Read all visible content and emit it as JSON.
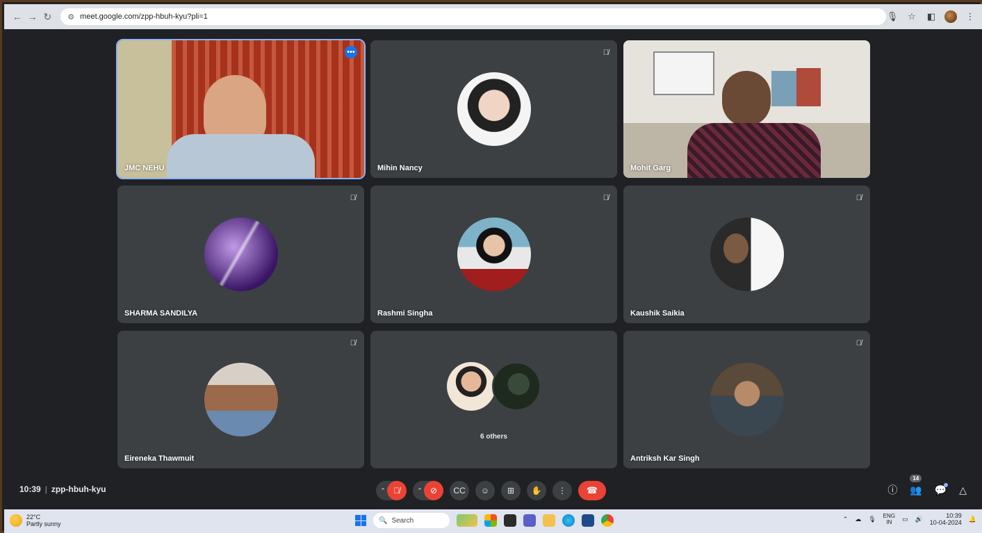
{
  "browser": {
    "url": "meet.google.com/zpp-hbuh-kyu?pli=1"
  },
  "tiles": [
    {
      "name": "JMC NEHU"
    },
    {
      "name": "Mihin Nancy"
    },
    {
      "name": "Mohit Garg"
    },
    {
      "name": "SHARMA SANDILYA"
    },
    {
      "name": "Rashmi Singha"
    },
    {
      "name": "Kaushik Saikia"
    },
    {
      "name": "Eireneka Thawmuit"
    },
    {
      "name": "6 others"
    },
    {
      "name": "Antriksh Kar Singh"
    }
  ],
  "meeting": {
    "time": "10:39",
    "separator": "|",
    "code": "zpp-hbuh-kyu",
    "participant_count": "14"
  },
  "taskbar": {
    "temperature": "22°C",
    "weather": "Partly sunny",
    "search_label": "Search",
    "lang_top": "ENG",
    "lang_bottom": "IN",
    "clock_time": "10:39",
    "clock_date": "10-04-2024"
  },
  "colors": {
    "accent": "#1a73e8",
    "end_call": "#ea4335",
    "tile_bg": "#3c4043",
    "meet_bg": "#202124"
  }
}
